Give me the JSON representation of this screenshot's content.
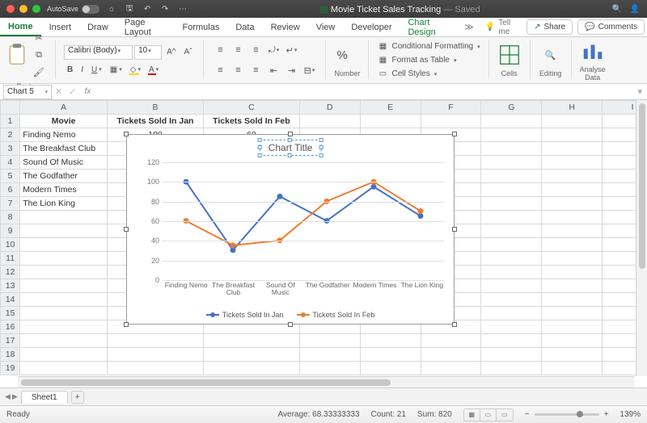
{
  "titlebar": {
    "autosave": "AutoSave",
    "doc_icon": "excel",
    "doc_name": "Movie Ticket Sales Tracking",
    "saved": "— Saved"
  },
  "tabs": {
    "items": [
      "Home",
      "Insert",
      "Draw",
      "Page Layout",
      "Formulas",
      "Data",
      "Review",
      "View",
      "Developer",
      "Chart Design"
    ],
    "active": 0,
    "green_extra": 9,
    "tellme": "Tell me",
    "share": "Share",
    "comments": "Comments"
  },
  "ribbon": {
    "paste": "Paste",
    "number": "Number",
    "cells": "Cells",
    "editing": "Editing",
    "analyse": "Analyse\nData",
    "font_name": "Calibri (Body)",
    "font_size": "10",
    "cf": "Conditional Formatting",
    "fat": "Format as Table",
    "cs": "Cell Styles"
  },
  "namebox": "Chart 5",
  "columns": [
    "A",
    "B",
    "C",
    "D",
    "E",
    "F",
    "G",
    "H",
    "I"
  ],
  "rows": 19,
  "sheet": {
    "headers": [
      "Movie",
      "Tickets Sold In Jan",
      "Tickets Sold In Feb"
    ],
    "data": [
      {
        "movie": "Finding Nemo",
        "jan": 100,
        "feb": 60
      },
      {
        "movie": "The Breakfast Club",
        "jan": 30,
        "feb": 35
      },
      {
        "movie": "Sound Of Music",
        "jan": null,
        "feb": null
      },
      {
        "movie": "The Godfather",
        "jan": null,
        "feb": null
      },
      {
        "movie": "Modern Times",
        "jan": null,
        "feb": null
      },
      {
        "movie": "The Lion King",
        "jan": null,
        "feb": null
      }
    ]
  },
  "chart_data": {
    "type": "line",
    "title": "Chart Title",
    "categories": [
      "Finding Nemo",
      "The Breakfast Club",
      "Sound Of Music",
      "The Godfather",
      "Modern Times",
      "The Lion King"
    ],
    "series": [
      {
        "name": "Tickets Sold In Jan",
        "color": "#4472C4",
        "values": [
          100,
          30,
          85,
          60,
          95,
          65
        ]
      },
      {
        "name": "Tickets Sold In Feb",
        "color": "#ED7D31",
        "values": [
          60,
          35,
          40,
          80,
          100,
          70
        ]
      }
    ],
    "ylim": [
      0,
      120
    ],
    "ytick": 20,
    "xlabel": "",
    "ylabel": ""
  },
  "sheettab": "Sheet1",
  "status": {
    "ready": "Ready",
    "avg_label": "Average:",
    "avg": "68.33333333",
    "count_label": "Count:",
    "count": "21",
    "sum_label": "Sum:",
    "sum": "820",
    "zoom": "139%"
  }
}
